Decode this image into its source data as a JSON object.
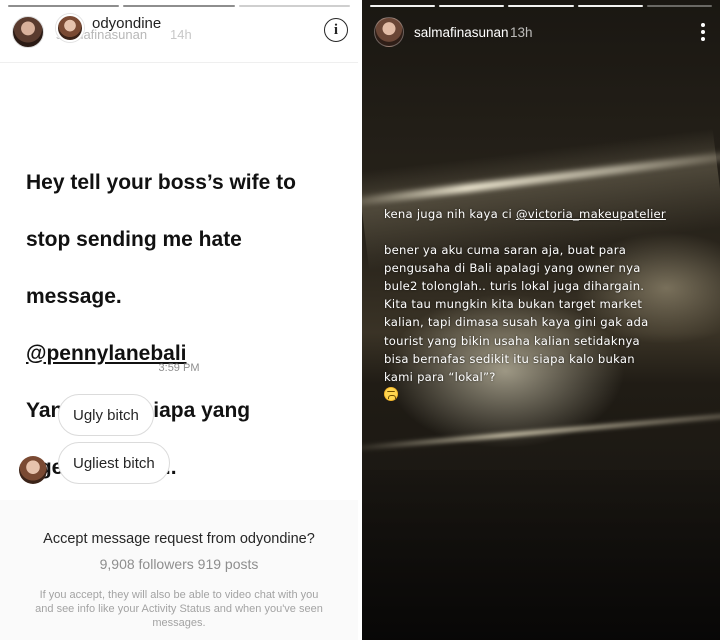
{
  "left_story": {
    "story_user": "salmafinasunan",
    "story_time": "14h",
    "dm_username": "odyondine",
    "info_icon": "info-icon",
    "message_lines": [
      "Hey tell your boss’s wife to",
      "stop sending me hate",
      "message.",
      "@pennylanebali",
      "Yang salah siapa yang",
      "ngegas siapa..."
    ],
    "timestamp": "3:59 PM",
    "bubbles": [
      "Ugly bitch",
      "Ugliest bitch"
    ],
    "request": {
      "title": "Accept message request from odyondine?",
      "stats": "9,908 followers 919 posts",
      "note": "If you accept, they will also be able to video chat with you and see info like your Activity Status and when you've seen messages."
    }
  },
  "right_story": {
    "username": "salmafinasunan",
    "time": "13h",
    "menu_icon": "more-vertical-icon",
    "caption_line1_prefix": "kena juga nih kaya ci ",
    "caption_line1_mention": "@victoria_makeupatelier",
    "caption_body": "bener ya aku cuma saran aja, buat para\npengusaha di Bali apalagi yang owner nya\nbule2 tolonglah..  turis lokal juga dihargain.\nKita tau mungkin kita bukan target market\nkalian, tapi dimasa susah kaya gini gak ada\ntourist yang bikin usaha kalian setidaknya\nbisa bernafas sedikit itu siapa kalo bukan\nkami para “lokal”?",
    "emoji": "weary-face-emoji"
  }
}
